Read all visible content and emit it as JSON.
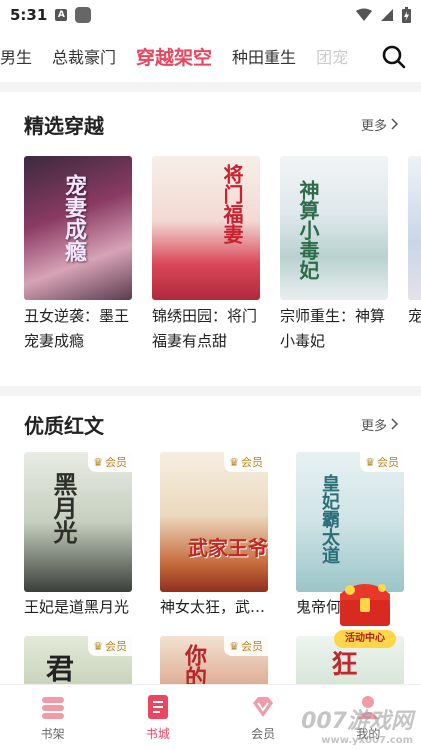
{
  "status_bar": {
    "time": "5:31",
    "a_icon": "A"
  },
  "tabs": [
    {
      "label": "男生",
      "state": "partial"
    },
    {
      "label": "总裁豪门",
      "state": "normal"
    },
    {
      "label": "穿越架空",
      "state": "active"
    },
    {
      "label": "种田重生",
      "state": "normal"
    },
    {
      "label": "团宠",
      "state": "fade"
    }
  ],
  "accent_color": "#e8475f",
  "section1": {
    "title": "精选穿越",
    "more": "更多",
    "books": [
      {
        "title": "丑女逆袭：墨王宠妻成瘾",
        "cover_text": "宠妻成瘾"
      },
      {
        "title": "锦绣田园：将门福妻有点甜",
        "cover_text": "将门福妻"
      },
      {
        "title": "宗师重生：神算小毒妃",
        "cover_text": "神算小毒妃"
      },
      {
        "title": "宠子",
        "cover_text": ""
      }
    ]
  },
  "section2": {
    "title": "优质红文",
    "more": "更多",
    "books": [
      {
        "title": "王妃是道黑月光",
        "cover_text": "黑月光",
        "vip": "会员"
      },
      {
        "title": "神女太狂，武家王爷",
        "cover_text": "武家王爷",
        "vip": "会员"
      },
      {
        "title": "鬼帝何",
        "cover_text": "皇妃霸太道",
        "vip": "会员"
      }
    ],
    "row2": [
      {
        "cover_text": "君",
        "vip": "会员"
      },
      {
        "cover_text": "你的",
        "vip": "会员"
      },
      {
        "cover_text": "狂",
        "vip": ""
      }
    ]
  },
  "activity": {
    "label": "活动中心"
  },
  "bottom_nav": [
    {
      "label": "书架",
      "icon": "bookshelf-icon"
    },
    {
      "label": "书城",
      "icon": "bookstore-icon",
      "active": true
    },
    {
      "label": "会员",
      "icon": "diamond-icon"
    },
    {
      "label": "我的",
      "icon": "profile-icon"
    }
  ],
  "watermark": {
    "main": "007游戏网",
    "sub": "www.yx007.com"
  }
}
